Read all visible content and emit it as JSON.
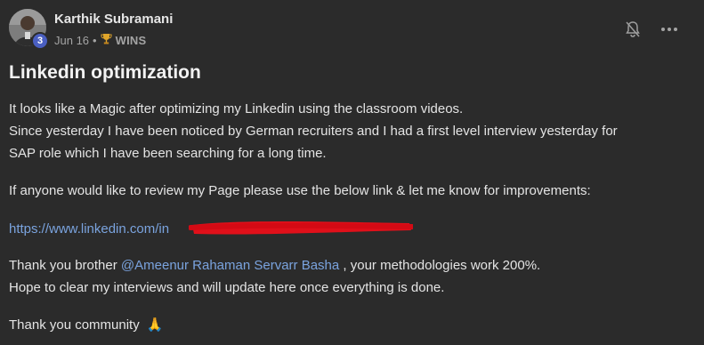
{
  "author": {
    "name": "Karthik Subramani",
    "level": "3"
  },
  "meta": {
    "date": "Jun 16",
    "separator": "•",
    "category_icon": "trophy-icon",
    "category": "WINS"
  },
  "actions": {
    "notification_icon": "bell-off-icon",
    "more_icon": "more-dots-icon"
  },
  "post": {
    "title": "Linkedin optimization",
    "line1": "It looks like a Magic after optimizing my Linkedin using the classroom videos.",
    "line2": "Since yesterday I have been noticed by German recruiters and I had a first level interview yesterday for",
    "line3": "SAP role which I have been searching for a long time.",
    "line4": "If anyone would like to review my Page please use the below link & let me know for improvements:",
    "link_prefix": "https://www.linkedin.com/in",
    "thanks_prefix": "Thank you brother ",
    "mention": "@Ameenur Rahaman Servarr Basha",
    "thanks_suffix": " , your methodologies work 200%.",
    "line_hope": "Hope to clear my interviews and will update here once everything is done.",
    "closing": "Thank you community",
    "closing_emoji": "🙏"
  },
  "colors": {
    "background": "#2b2b2b",
    "link": "#7aa3de",
    "badge": "#4a5fc1",
    "redaction": "#e0101a"
  }
}
